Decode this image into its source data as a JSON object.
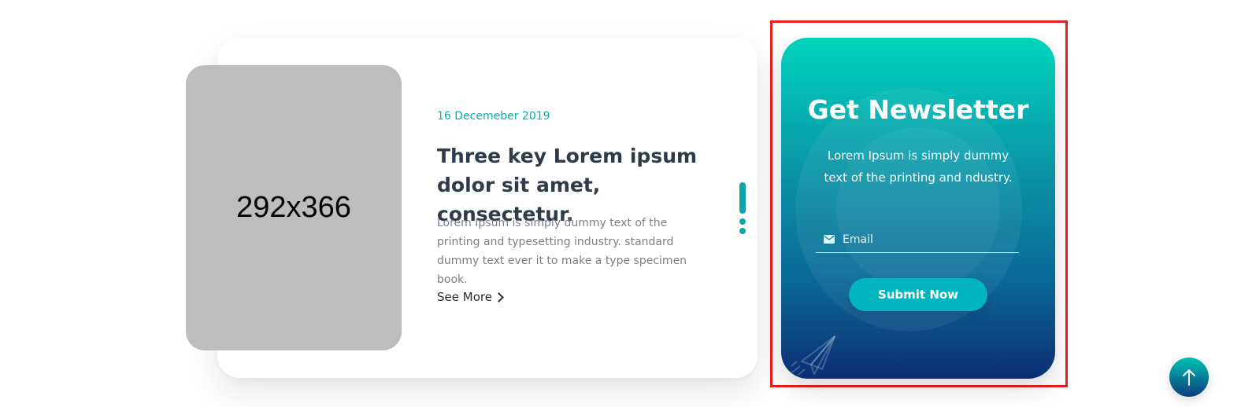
{
  "blog_card": {
    "image_placeholder": "292x366",
    "date": "16 Decemeber 2019",
    "title": "Three key Lorem ipsum dolor sit amet, consectetur.",
    "description": "Lorem Ipsum is simply dummy text of the printing and typesetting industry. standard dummy text ever it to make a type specimen book.",
    "see_more_label": "See More",
    "see_more_icon": "chevron-right-icon"
  },
  "newsletter": {
    "title": "Get Newsletter",
    "text": "Lorem Ipsum is simply dummy text of the printing and ndustry.",
    "email_placeholder": "Email",
    "email_icon": "envelope-icon",
    "submit_label": "Submit Now",
    "decoration_icon": "paper-plane-icon",
    "colors": {
      "gradient_top": "#00d4bc",
      "gradient_bottom": "#0d2e74",
      "button": "#00b5bf"
    }
  },
  "scroll_top": {
    "icon": "arrow-up-icon"
  },
  "colors": {
    "accent": "#00aeb4",
    "title": "#2f3a4a",
    "highlight_border": "#ea1e1e"
  }
}
